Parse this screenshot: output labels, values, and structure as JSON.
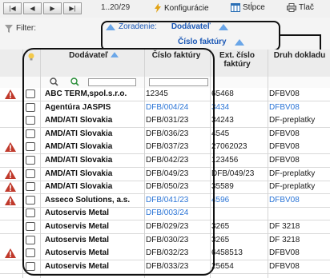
{
  "toolbar": {
    "pager": "1..20/29",
    "configure_label": "Konfigurácie",
    "columns_label": "Stĺpce",
    "print_label": "Tlač"
  },
  "filter": {
    "label": "Filter:"
  },
  "sorting": {
    "label": "Zoradenie:",
    "primary": "Dodávateľ",
    "secondary": "Číslo faktúry"
  },
  "columns": {
    "supplier": "Dodávateľ",
    "invoice_no": "Číslo faktúry",
    "ext_no": "Ext. číslo faktúry",
    "doc_type": "Druh dokladu"
  },
  "rows": [
    {
      "warn": true,
      "supplier": "ABC TERM,spol.s.r.o.",
      "invoice": "12345",
      "ext": "65468",
      "type": "DFBV08",
      "link": false
    },
    {
      "warn": false,
      "supplier": "Agentúra JASPIS",
      "invoice": "DFB/004/24",
      "ext": "3434",
      "type": "DFBV08",
      "link": true
    },
    {
      "warn": false,
      "supplier": "AMD/ATI Slovakia",
      "invoice": "DFB/031/23",
      "ext": "34243",
      "type": "DF-preplatky",
      "link": false
    },
    {
      "warn": false,
      "supplier": "AMD/ATI Slovakia",
      "invoice": "DFB/036/23",
      "ext": "4545",
      "type": "DFBV08",
      "link": false
    },
    {
      "warn": true,
      "supplier": "AMD/ATI Slovakia",
      "invoice": "DFB/037/23",
      "ext": "27062023",
      "type": "DFBV08",
      "link": false
    },
    {
      "warn": false,
      "supplier": "AMD/ATI Slovakia",
      "invoice": "DFB/042/23",
      "ext": "123456",
      "type": "DFBV08",
      "link": false
    },
    {
      "warn": true,
      "supplier": "AMD/ATI Slovakia",
      "invoice": "DFB/049/23",
      "ext": "DFB/049/23",
      "type": "DF-preplatky",
      "link": false
    },
    {
      "warn": true,
      "supplier": "AMD/ATI Slovakia",
      "invoice": "DFB/050/23",
      "ext": "35589",
      "type": "DF-preplatky",
      "link": false
    },
    {
      "warn": true,
      "supplier": "Asseco Solutions, a.s.",
      "invoice": "DFB/041/23",
      "ext": "4596",
      "type": "DFBV08",
      "link": true
    },
    {
      "warn": false,
      "supplier": "Autoservis Metal",
      "invoice": "DFB/003/24",
      "ext": "",
      "type": "",
      "link": true
    },
    {
      "warn": false,
      "supplier": "Autoservis Metal",
      "invoice": "DFB/029/23",
      "ext": "3265",
      "type": "DF 3218",
      "link": false
    },
    {
      "warn": false,
      "supplier": "Autoservis Metal",
      "invoice": "DFB/030/23",
      "ext": "3265",
      "type": "DF 3218",
      "link": false
    },
    {
      "warn": true,
      "supplier": "Autoservis Metal",
      "invoice": "DFB/032/23",
      "ext": "6458513",
      "type": "DFBV08",
      "link": false
    },
    {
      "warn": false,
      "supplier": "Autoservis Metal",
      "invoice": "DFB/033/23",
      "ext": "25654",
      "type": "DFBV08",
      "link": false
    }
  ],
  "colors": {
    "link": "#2a74d6",
    "warn": "#c0392b",
    "annotation": "#111111"
  }
}
